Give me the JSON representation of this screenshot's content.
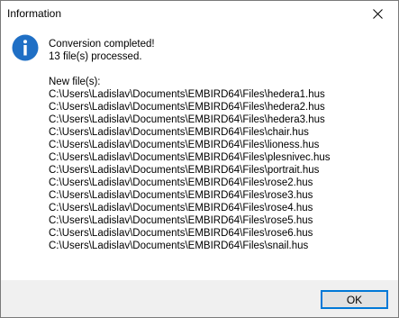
{
  "window": {
    "title": "Information",
    "close_icon": "close-icon"
  },
  "message": {
    "icon": "info-icon",
    "icon_color": "#1f6fc5",
    "headline": "Conversion completed!",
    "processed": "13 file(s) processed.",
    "new_files_label": "New file(s):",
    "files": [
      "C:\\Users\\Ladislav\\Documents\\EMBIRD64\\Files\\hedera1.hus",
      "C:\\Users\\Ladislav\\Documents\\EMBIRD64\\Files\\hedera2.hus",
      "C:\\Users\\Ladislav\\Documents\\EMBIRD64\\Files\\hedera3.hus",
      "C:\\Users\\Ladislav\\Documents\\EMBIRD64\\Files\\chair.hus",
      "C:\\Users\\Ladislav\\Documents\\EMBIRD64\\Files\\lioness.hus",
      "C:\\Users\\Ladislav\\Documents\\EMBIRD64\\Files\\plesnivec.hus",
      "C:\\Users\\Ladislav\\Documents\\EMBIRD64\\Files\\portrait.hus",
      "C:\\Users\\Ladislav\\Documents\\EMBIRD64\\Files\\rose2.hus",
      "C:\\Users\\Ladislav\\Documents\\EMBIRD64\\Files\\rose3.hus",
      "C:\\Users\\Ladislav\\Documents\\EMBIRD64\\Files\\rose4.hus",
      "C:\\Users\\Ladislav\\Documents\\EMBIRD64\\Files\\rose5.hus",
      "C:\\Users\\Ladislav\\Documents\\EMBIRD64\\Files\\rose6.hus",
      "C:\\Users\\Ladislav\\Documents\\EMBIRD64\\Files\\snail.hus"
    ]
  },
  "footer": {
    "ok_label": "OK",
    "accent_color": "#0078d7"
  }
}
